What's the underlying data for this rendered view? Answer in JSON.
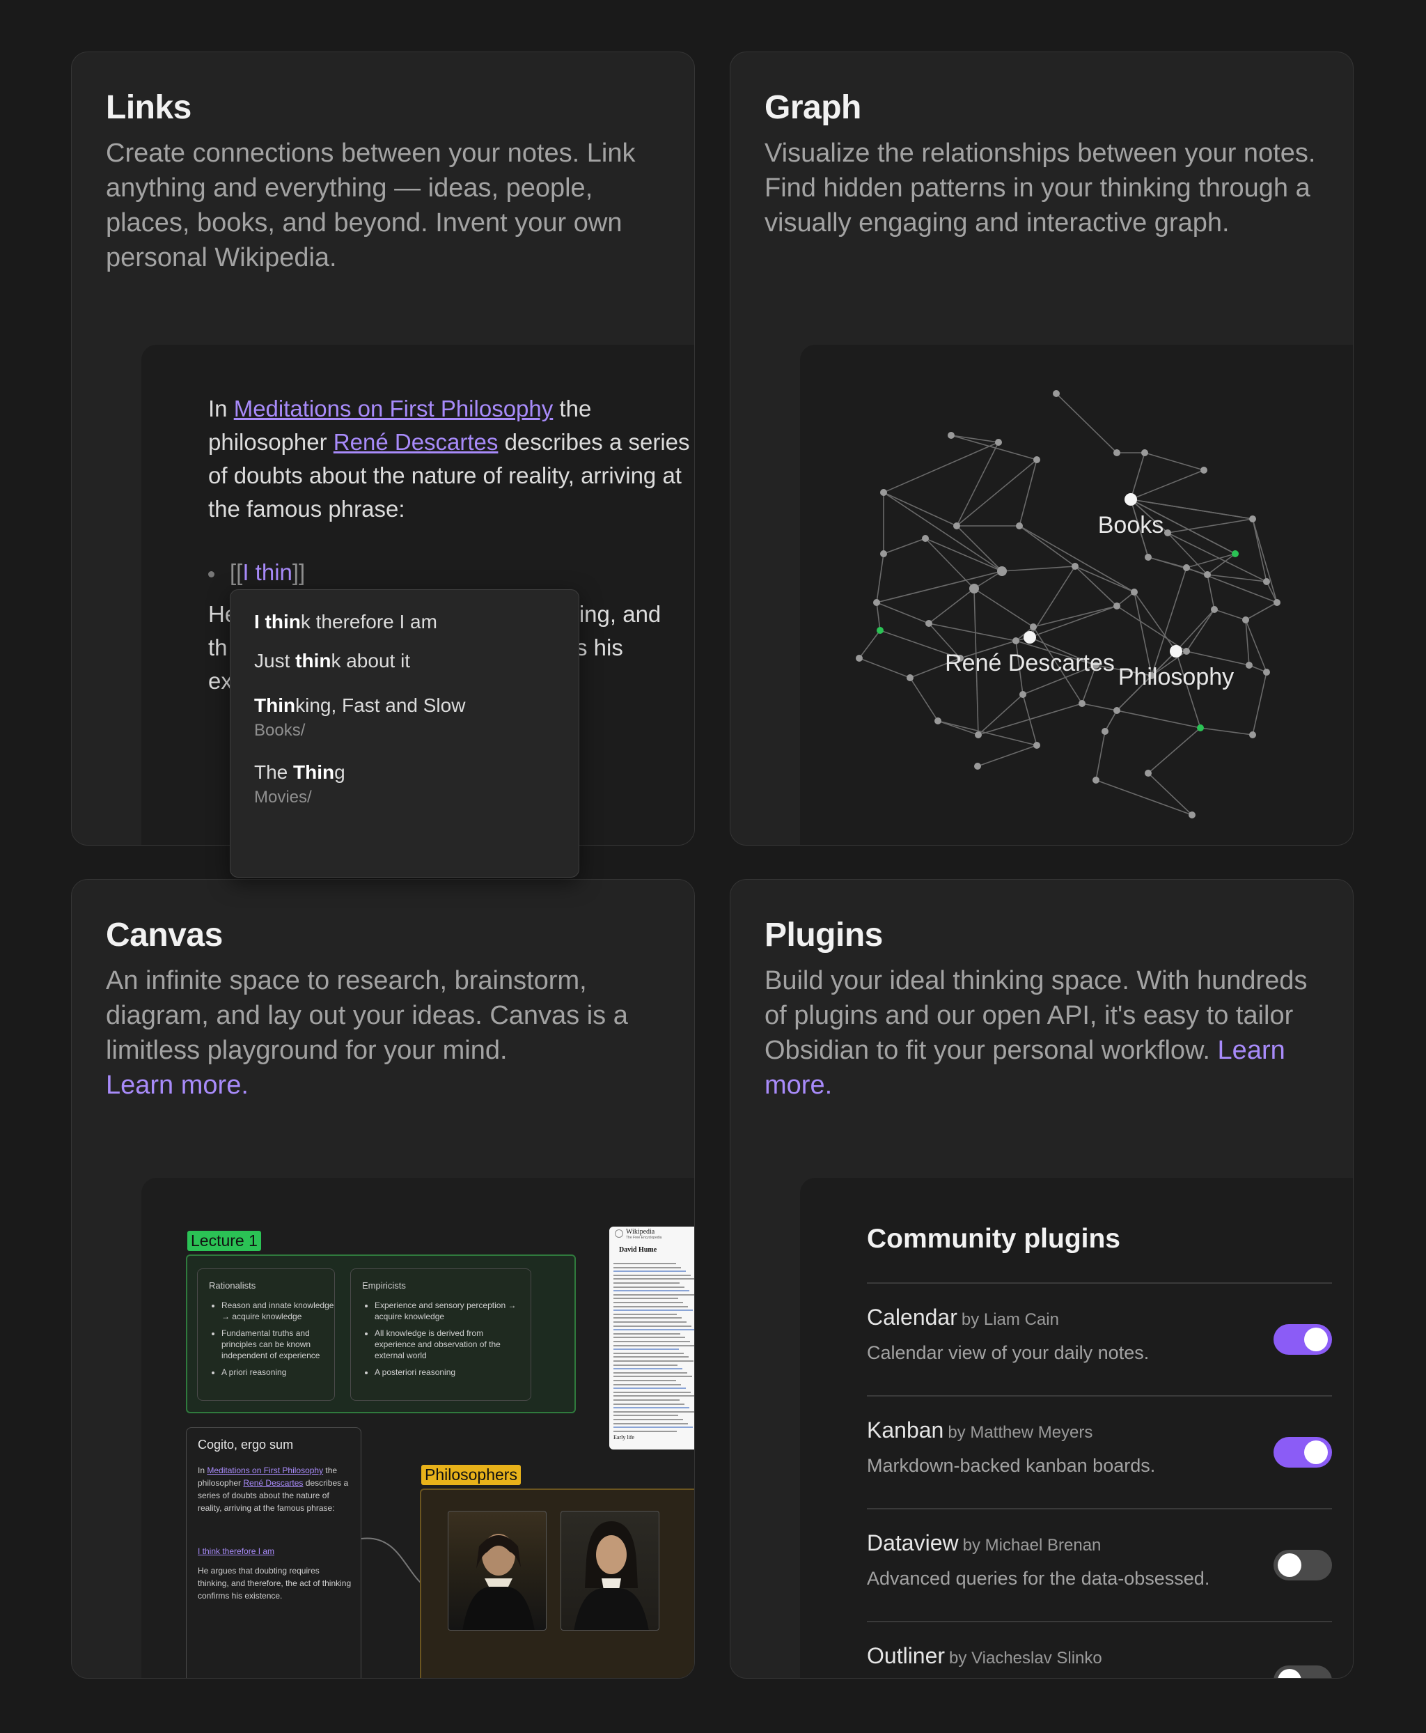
{
  "cards": {
    "links": {
      "title": "Links",
      "description": "Create connections between your notes. Link anything and everything — ideas, people, places, books, and beyond. Invent your own personal Wikipedia."
    },
    "graph": {
      "title": "Graph",
      "description": "Visualize the relationships between your notes. Find hidden patterns in your thinking through a visually engaging and interactive graph."
    },
    "canvas": {
      "title": "Canvas",
      "description": "An infinite space to research, brainstorm, diagram, and lay out your ideas. Canvas is a limitless playground for your mind.",
      "learn_more": "Learn more."
    },
    "plugins": {
      "title": "Plugins",
      "description": "Build your ideal thinking space. With hundreds of plugins and our open API, it's easy to tailor Obsidian to fit your personal workflow.",
      "learn_more": "Learn more."
    }
  },
  "editor": {
    "p1_pre": "In ",
    "link1": "Meditations on First Philosophy",
    "p1_mid": " the philosopher ",
    "link2": "René Descartes",
    "p1_post": " describes a series of doubts about the nature of reality, arriving at the famous phrase:",
    "bracket_open": "[[",
    "typed": "I thin",
    "bracket_close": "]]",
    "line2_left": "He",
    "line2_right": "nking, and",
    "line3_left": "th",
    "line3_right": "s his",
    "line4_left": "ex"
  },
  "suggestions": [
    {
      "bold": "I thin",
      "rest": "k therefore I am",
      "folder": ""
    },
    {
      "pre": "Just ",
      "bold": "thin",
      "rest": "k about it",
      "folder": ""
    },
    {
      "bold": "Thin",
      "rest": "king, Fast and Slow",
      "folder": "Books/"
    },
    {
      "pre": "The ",
      "bold": "Thin",
      "rest": "g",
      "folder": "Movies/"
    }
  ],
  "graph": {
    "labels": [
      "Books",
      "René Descartes",
      "Philosophy"
    ],
    "node_color": "#9a9a9a",
    "highlight_color": "#2bc255",
    "edge_color": "#6a6a6a"
  },
  "canvas": {
    "lecture_tag": "Lecture 1",
    "rationalists": {
      "title": "Rationalists",
      "items": [
        "Reason and innate knowledge → acquire knowledge",
        "Fundamental truths and principles can be known independent of experience",
        "A priori reasoning"
      ]
    },
    "empiricists": {
      "title": "Empiricists",
      "items": [
        "Experience and sensory perception → acquire knowledge",
        "All knowledge is derived from experience and observation of the external world",
        "A posteriori reasoning"
      ]
    },
    "note": {
      "title": "Cogito, ergo sum",
      "pre": "In ",
      "link1": "Meditations on First Philosophy",
      "mid": " the philosopher ",
      "link2": "René Descartes",
      "post": " describes a series of doubts about the nature of reality, arriving at the famous phrase:",
      "quote_link": "I think therefore I am",
      "body2": "He argues that doubting requires thinking, and therefore, the act of thinking confirms his existence."
    },
    "philosophers_tag": "Philosophers",
    "wiki": {
      "brand": "Wikipedia",
      "brand_sub": "The Free Encyclopedia",
      "title": "David Hume",
      "section": "Early life"
    }
  },
  "plugins_panel": {
    "title": "Community plugins",
    "items": [
      {
        "name": "Calendar",
        "author": "by Liam Cain",
        "description": "Calendar view of your daily notes.",
        "enabled": true
      },
      {
        "name": "Kanban",
        "author": "by Matthew Meyers",
        "description": "Markdown-backed kanban boards.",
        "enabled": true
      },
      {
        "name": "Dataview",
        "author": "by Michael Brenan",
        "description": "Advanced queries for the data-obsessed.",
        "enabled": false
      },
      {
        "name": "Outliner",
        "author": "by Viacheslav Slinko",
        "description": "",
        "enabled": false
      }
    ]
  },
  "colors": {
    "accent": "#a88bfa",
    "toggle_on": "#8b5cf6",
    "lecture_green": "#2bc255",
    "philosophers_yellow": "#e8b21a"
  }
}
